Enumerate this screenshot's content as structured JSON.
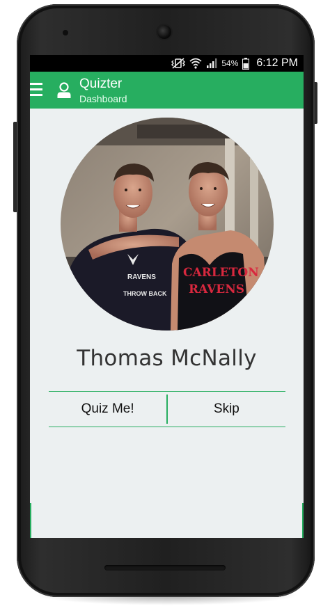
{
  "status_bar": {
    "battery_percent": "54%",
    "time": "6:12 PM",
    "icons": [
      "vibrate-mute-icon",
      "wifi-icon",
      "signal-icon",
      "battery-icon"
    ]
  },
  "app_bar": {
    "title": "Quizter",
    "subtitle": "Dashboard",
    "icons": [
      "menu-icon",
      "user-icon"
    ],
    "color": "#27ae60"
  },
  "profile": {
    "name": "Thomas McNally",
    "shirt_left": "RAVENS",
    "shirt_left_line2": "THROW BACK",
    "shirt_right_line1": "CARLETON",
    "shirt_right_line2": "RAVENS"
  },
  "actions": {
    "primary_label": "Quiz Me!",
    "secondary_label": "Skip",
    "accent_color": "#27ae60"
  },
  "screen_background": "#ecf0f1"
}
